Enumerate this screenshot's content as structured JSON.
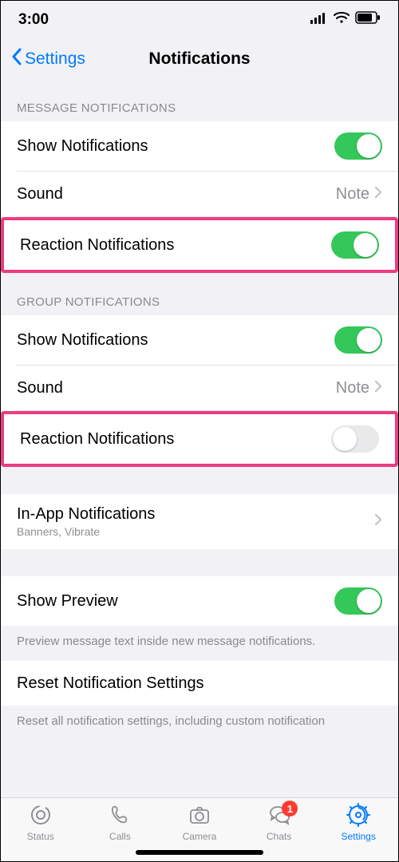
{
  "statusbar": {
    "time": "3:00"
  },
  "nav": {
    "back": "Settings",
    "title": "Notifications"
  },
  "sections": {
    "message": {
      "header": "MESSAGE NOTIFICATIONS",
      "show": "Show Notifications",
      "sound": "Sound",
      "sound_value": "Note",
      "reaction": "Reaction Notifications"
    },
    "group": {
      "header": "GROUP NOTIFICATIONS",
      "show": "Show Notifications",
      "sound": "Sound",
      "sound_value": "Note",
      "reaction": "Reaction Notifications"
    },
    "inapp": {
      "label": "In-App Notifications",
      "sub": "Banners, Vibrate"
    },
    "preview": {
      "label": "Show Preview",
      "footer": "Preview message text inside new message notifications."
    },
    "reset": {
      "label": "Reset Notification Settings",
      "footer": "Reset all notification settings, including custom notification"
    }
  },
  "tabs": {
    "status": "Status",
    "calls": "Calls",
    "camera": "Camera",
    "chats": "Chats",
    "chats_badge": "1",
    "settings": "Settings"
  }
}
